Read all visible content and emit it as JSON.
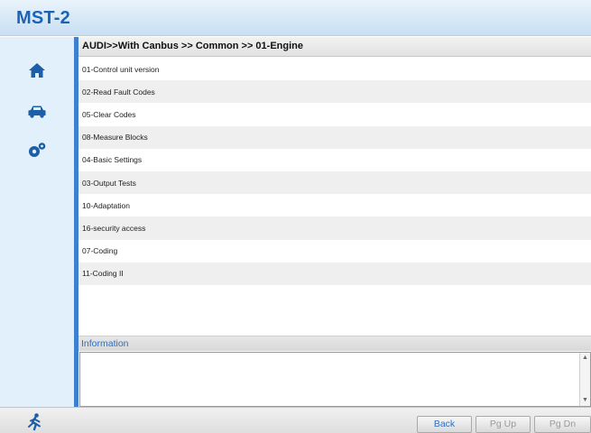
{
  "app": {
    "title": "MST-2"
  },
  "sidebar": {
    "items": [
      {
        "name": "home",
        "icon": "home-icon"
      },
      {
        "name": "vehicle",
        "icon": "car-icon"
      },
      {
        "name": "settings",
        "icon": "gears-icon"
      }
    ]
  },
  "breadcrumb": "AUDI>>With Canbus >> Common >> 01-Engine",
  "menu": {
    "items": [
      "01-Control unit version",
      "02-Read Fault Codes",
      "05-Clear Codes",
      "08-Measure Blocks",
      "04-Basic Settings",
      "03-Output Tests",
      "10-Adaptation",
      "16-security access",
      "07-Coding",
      "11-Coding II"
    ]
  },
  "information": {
    "label": "Information",
    "content": ""
  },
  "footer": {
    "exit_icon": "exit-runner-icon",
    "back_label": "Back",
    "pgup_label": "Pg Up",
    "pgdn_label": "Pg Dn"
  },
  "colors": {
    "accent": "#1b63b7",
    "sidebar_bg": "#e1f0fb",
    "rule": "#3f7fd0",
    "disabled_text": "#9a9a9a"
  }
}
